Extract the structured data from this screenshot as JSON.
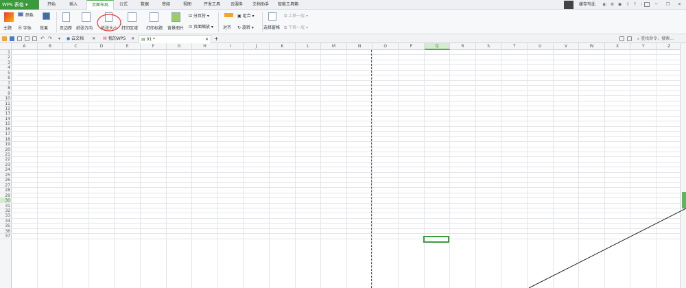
{
  "menubar": {
    "app_name": "WPS 表格",
    "tabs": [
      "开始",
      "插入",
      "页面布局",
      "公式",
      "数据",
      "审阅",
      "视图",
      "开发工具",
      "云服务",
      "文档助手",
      "智能工具箱"
    ],
    "active_tab": "页面布局",
    "user_label": "缓存写此"
  },
  "ribbon": {
    "theme_label": "主题",
    "colors_label": "颜色",
    "fonts_label": "字体",
    "effects_label": "效果",
    "margins_label": "页边距",
    "orientation_label": "纸张方向",
    "size_label": "纸张大小",
    "print_area_label": "打印区域",
    "print_titles_label": "打印标题",
    "background_label": "背景图片",
    "breaks_label": "分页符",
    "scale_label": "页面缩放",
    "align_label": "对齐",
    "group_label": "组合",
    "rotate_label": "旋转",
    "selection_pane_label": "选择窗格",
    "bring_forward_label": "上移一层",
    "send_backward_label": "下移一层"
  },
  "doctabs": {
    "cloud_doc": "云文档",
    "my_wps": "我的WPS",
    "file_tab": "01 *",
    "search_placeholder": "查找命令、搜索..."
  },
  "sheet": {
    "columns": [
      "A",
      "B",
      "C",
      "D",
      "E",
      "F",
      "G",
      "H",
      "I",
      "J",
      "K",
      "L",
      "M",
      "N",
      "O",
      "P",
      "Q",
      "R",
      "S",
      "T",
      "U",
      "V",
      "W",
      "X",
      "Y",
      "Z"
    ],
    "selected_column": "Q",
    "rows": [
      "1",
      "2",
      "3",
      "4",
      "5",
      "6",
      "7",
      "8",
      "9",
      "10",
      "11",
      "12",
      "13",
      "14",
      "15",
      "16",
      "17",
      "18",
      "19",
      "20",
      "21",
      "22",
      "23",
      "24",
      "25",
      "26",
      "27",
      "28",
      "29",
      "30",
      "31",
      "32",
      "33",
      "34",
      "35",
      "36",
      "37"
    ],
    "selected_row": "30"
  },
  "colors": {
    "accent": "#3b9a3b",
    "selection": "#3c9b3c",
    "annotation": "#e53935"
  }
}
